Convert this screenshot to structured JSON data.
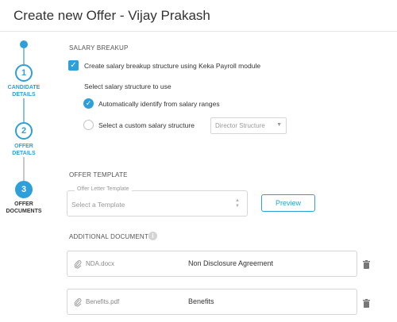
{
  "header": {
    "title": "Create new Offer - Vijay Prakash"
  },
  "stepper": {
    "steps": [
      {
        "number": "1",
        "label_line1": "CANDIDATE",
        "label_line2": "DETAILS"
      },
      {
        "number": "2",
        "label_line1": "OFFER",
        "label_line2": "DETAILS"
      },
      {
        "number": "3",
        "label_line1": "OFFER",
        "label_line2": "DOCUMENTS"
      }
    ],
    "active_step": 3
  },
  "salary": {
    "section_title": "SALARY BREAKUP",
    "create_checkbox_label": "Create salary breakup structure using Keka Payroll module",
    "create_checked": true,
    "structure_prompt": "Select salary structure to use",
    "option_auto": "Automatically identify from salary ranges",
    "option_custom": "Select a custom salary structure",
    "selected_option": "auto",
    "custom_select_value": "Director Structure"
  },
  "offer_template": {
    "section_title": "OFFER TEMPLATE",
    "field_label": "Offer Letter Template",
    "placeholder": "Select a Template",
    "preview_label": "Preview"
  },
  "additional_documents": {
    "section_title": "ADDITIONAL DOCUMENTS",
    "info_symbol": "i",
    "items": [
      {
        "file_name": "NDA.docx",
        "document_name": "Non Disclosure Agreement"
      },
      {
        "file_name": "Benefits.pdf",
        "document_name": "Benefits"
      }
    ]
  },
  "colors": {
    "accent": "#2d9fdb",
    "border": "#d6d6d6",
    "muted": "#9a9a9a"
  },
  "icons": [
    "checkmark-icon",
    "chevron-down-icon",
    "sort-arrows-icon",
    "info-icon",
    "paperclip-icon",
    "trash-icon"
  ]
}
